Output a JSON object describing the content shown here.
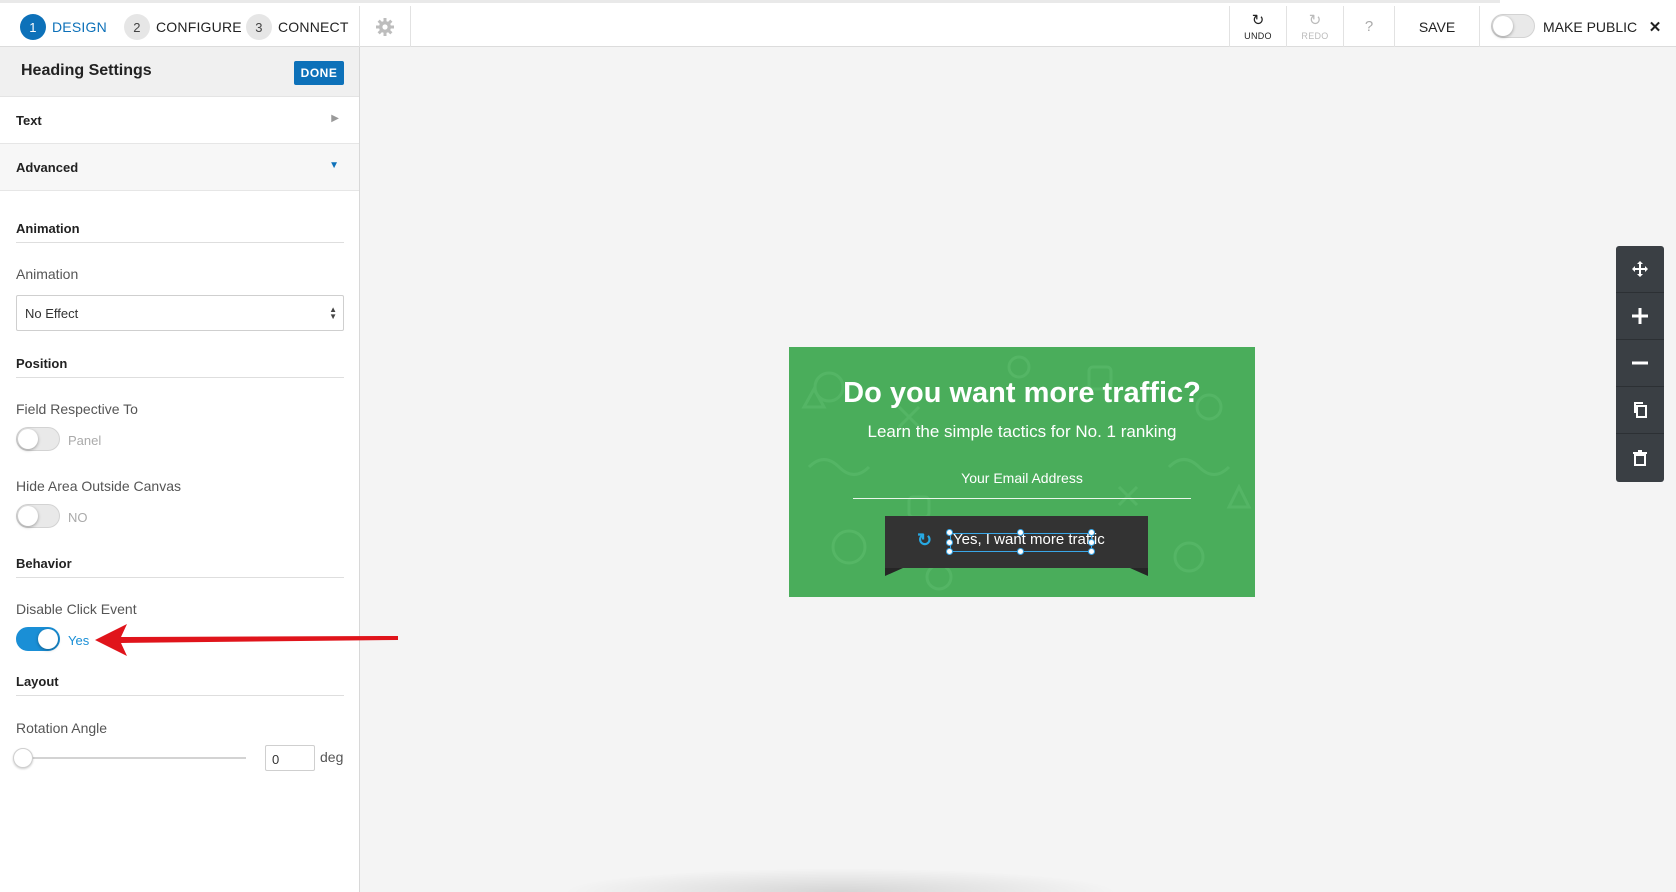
{
  "steps": [
    {
      "num": "1",
      "label": "DESIGN"
    },
    {
      "num": "2",
      "label": "CONFIGURE"
    },
    {
      "num": "3",
      "label": "CONNECT"
    }
  ],
  "toolbar": {
    "settings_icon": "gear-icon",
    "undo_label": "UNDO",
    "redo_label": "REDO",
    "help_label": "?",
    "save_label": "SAVE",
    "make_public_label": "MAKE PUBLIC",
    "make_public_on": false,
    "close_label": "✕"
  },
  "sidebar": {
    "title": "Heading Settings",
    "done_label": "DONE",
    "accordions": [
      {
        "label": "Text",
        "open": false
      },
      {
        "label": "Advanced",
        "open": true
      }
    ],
    "animation": {
      "section": "Animation",
      "field_label": "Animation",
      "selected": "No Effect"
    },
    "position": {
      "section": "Position",
      "field_respective_label": "Field Respective To",
      "field_respective_value": "Panel",
      "hide_area_label": "Hide Area Outside Canvas",
      "hide_area_value": "NO"
    },
    "behavior": {
      "section": "Behavior",
      "disable_click_label": "Disable Click Event",
      "disable_click_value": "Yes",
      "disable_click_on": true
    },
    "layout": {
      "section": "Layout",
      "rotation_label": "Rotation Angle",
      "rotation_value": "0",
      "rotation_unit": "deg"
    }
  },
  "optin": {
    "heading": "Do you want more traffic?",
    "subheading": "Learn the simple tactics for No. 1 ranking",
    "email_placeholder": "Your Email Address",
    "button_text": "Yes, I want more traffic",
    "background_color": "#4aad5b"
  },
  "floating_tools": [
    "move-icon",
    "plus-icon",
    "minus-icon",
    "duplicate-icon",
    "trash-icon"
  ],
  "colors": {
    "accent": "#0d71b9",
    "toggle_on": "#1a8fd6",
    "annotation": "#e0141b"
  }
}
